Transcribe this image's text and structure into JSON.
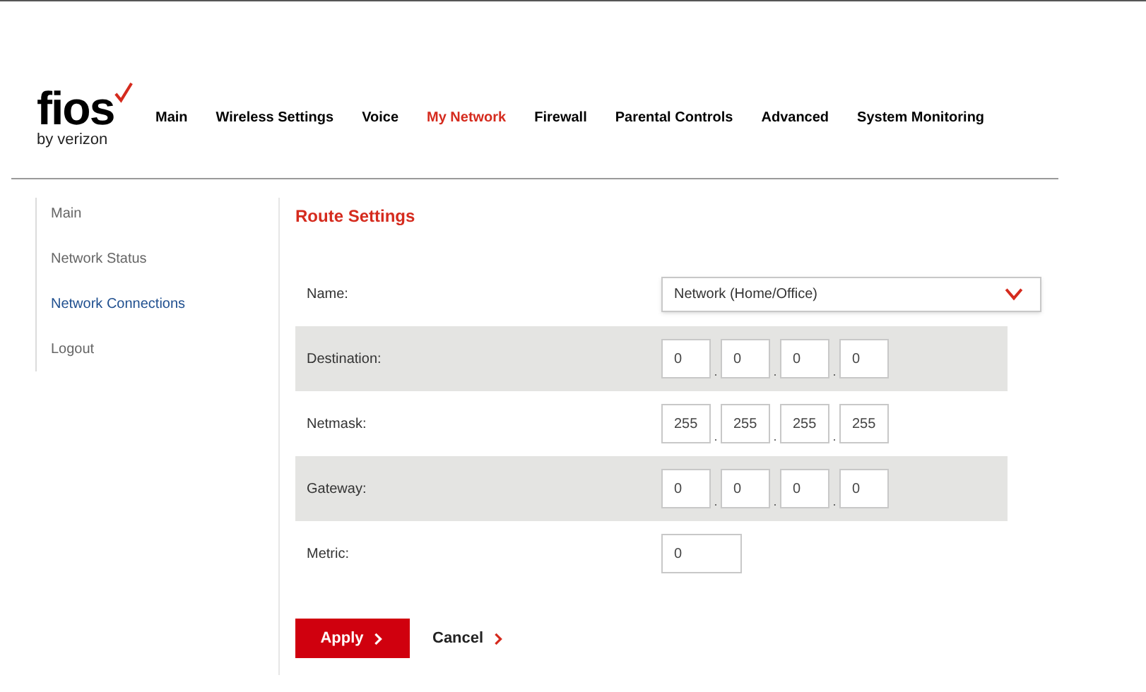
{
  "logo": {
    "wordmark": "fios",
    "tagline": "by verizon"
  },
  "nav": [
    {
      "label": "Main",
      "selected": false
    },
    {
      "label": "Wireless Settings",
      "selected": false
    },
    {
      "label": "Voice",
      "selected": false
    },
    {
      "label": "My Network",
      "selected": true
    },
    {
      "label": "Firewall",
      "selected": false
    },
    {
      "label": "Parental Controls",
      "selected": false
    },
    {
      "label": "Advanced",
      "selected": false
    },
    {
      "label": "System Monitoring",
      "selected": false
    }
  ],
  "sidebar": {
    "items": [
      {
        "label": "Main",
        "selected": false
      },
      {
        "label": "Network Status",
        "selected": false
      },
      {
        "label": "Network Connections",
        "selected": true
      },
      {
        "label": "Logout",
        "selected": false
      }
    ]
  },
  "form": {
    "title": "Route Settings",
    "rows": [
      {
        "kind": "select",
        "label": "Name:",
        "value": "Network (Home/Office)"
      },
      {
        "kind": "ip",
        "label": "Destination:",
        "octets": [
          "0",
          "0",
          "0",
          "0"
        ],
        "separators": [
          ".",
          ".",
          "."
        ]
      },
      {
        "kind": "ip",
        "label": "Netmask:",
        "octets": [
          "255",
          "255",
          "255",
          "255"
        ],
        "separators": [
          ".",
          ".",
          "."
        ]
      },
      {
        "kind": "ip",
        "label": "Gateway:",
        "octets": [
          "0",
          "0",
          "0",
          "0"
        ],
        "separators": [
          ".",
          ".",
          "."
        ]
      },
      {
        "kind": "text",
        "label": "Metric:",
        "value": "0"
      }
    ]
  },
  "buttons": [
    {
      "kind": "primary",
      "label": "Apply"
    },
    {
      "kind": "link",
      "label": "Cancel"
    }
  ]
}
